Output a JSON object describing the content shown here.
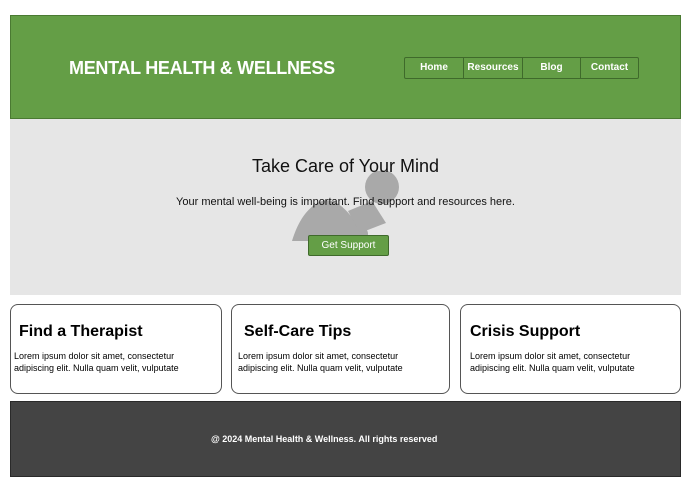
{
  "header": {
    "site_title": "MENTAL HEALTH & WELLNESS",
    "nav": [
      {
        "label": "Home"
      },
      {
        "label": "Resources"
      },
      {
        "label": "Blog"
      },
      {
        "label": "Contact"
      }
    ]
  },
  "hero": {
    "title": "Take Care of Your Mind",
    "subtitle": "Your mental well-being is important. Find support and resources here.",
    "button_label": "Get Support",
    "image_icon": "person-silhouette-icon"
  },
  "cards": [
    {
      "title": "Find a Therapist",
      "text": "Lorem ipsum dolor sit amet, consectetur adipiscing elit. Nulla quam velit, vulputate"
    },
    {
      "title": "Self-Care Tips",
      "text": "Lorem ipsum dolor sit amet, consectetur adipiscing elit. Nulla quam velit, vulputate"
    },
    {
      "title": "Crisis Support",
      "text": "Lorem ipsum dolor sit amet, consectetur adipiscing elit. Nulla quam velit, vulputate"
    }
  ],
  "footer": {
    "text": "@ 2024 Mental Health & Wellness. All rights reserved"
  },
  "colors": {
    "brand_green": "#649e46",
    "hero_background": "#e6e6e6",
    "footer_background": "#444444"
  }
}
